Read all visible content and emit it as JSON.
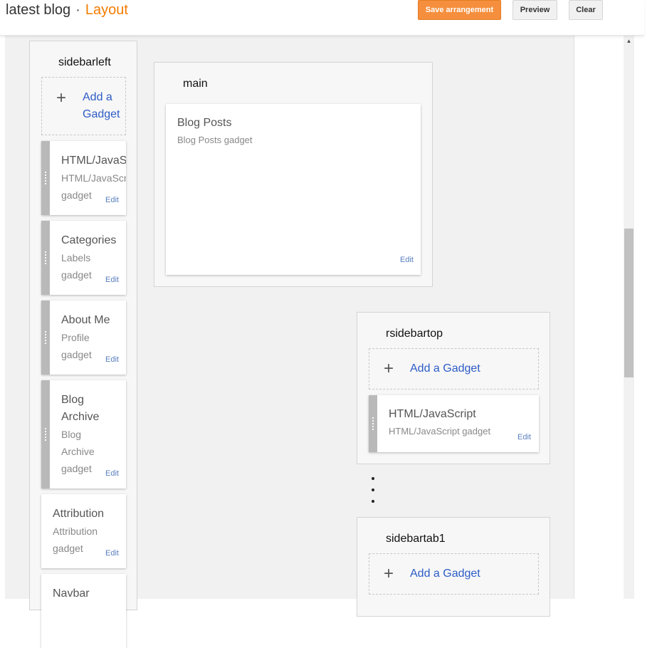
{
  "header": {
    "blog_name": "latest blog",
    "separator": "·",
    "page_name": "Layout",
    "save_label": "Save arrangement",
    "preview_label": "Preview",
    "clear_label": "Clear"
  },
  "colors": {
    "accent": "#f57c00",
    "save_bg": "#f58f3d",
    "link": "#2d5cc6"
  },
  "add_gadget": {
    "line1": "Add a",
    "line2": "Gadget",
    "full": "Add a Gadget"
  },
  "sidebarleft": {
    "title": "sidebarleft",
    "gadgets": [
      {
        "title": "HTML/JavaScript",
        "sub1": "HTML/JavaScript",
        "sub2": "gadget",
        "edit": "Edit"
      },
      {
        "title": "Categories",
        "sub1": "Labels",
        "sub2": "gadget",
        "edit": "Edit"
      },
      {
        "title": "About Me",
        "sub1": "Profile",
        "sub2": "gadget",
        "edit": "Edit"
      },
      {
        "title1": "Blog",
        "title2": "Archive",
        "sub1": "Blog",
        "sub2": "Archive",
        "sub3": "gadget",
        "edit": "Edit"
      },
      {
        "title": "Attribution",
        "sub1": "Attribution",
        "sub2": "gadget",
        "edit": "Edit"
      },
      {
        "title": "Navbar"
      }
    ]
  },
  "main": {
    "title": "main",
    "gadget": {
      "title": "Blog Posts",
      "sub": "Blog Posts gadget",
      "edit": "Edit"
    }
  },
  "rsidebartop": {
    "title": "rsidebartop",
    "gadget": {
      "title": "HTML/JavaScript",
      "sub": "HTML/JavaScript gadget",
      "edit": "Edit"
    }
  },
  "sidebartab1": {
    "title": "sidebartab1"
  }
}
